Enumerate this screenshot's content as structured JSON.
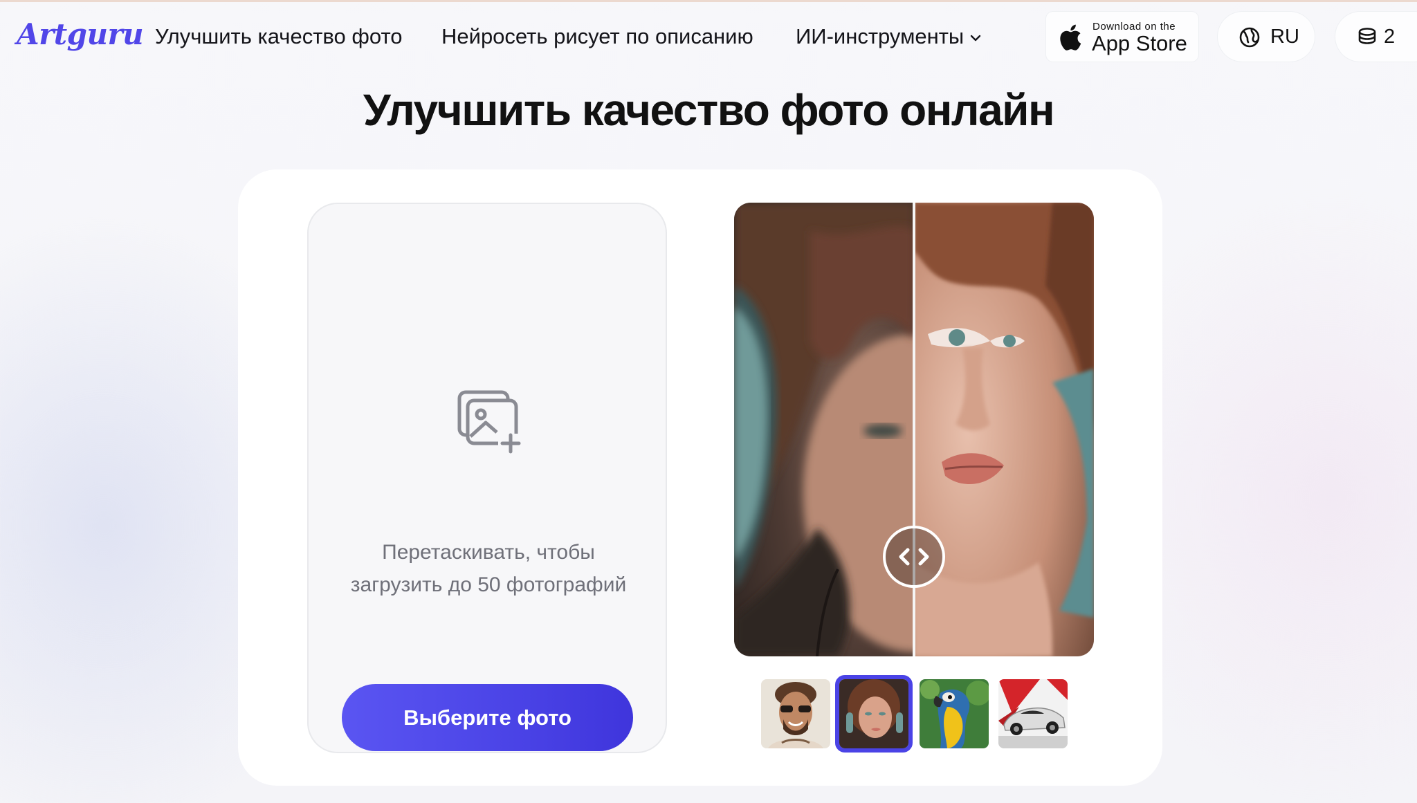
{
  "header": {
    "logo": "Artguru",
    "nav": {
      "enhance": "Улучшить качество фото",
      "generate": "Нейросеть рисует по описанию",
      "tools": "ИИ-инструменты"
    },
    "app_store": {
      "small": "Download on the",
      "big": "App Store"
    },
    "language": "RU",
    "credits": "2"
  },
  "main": {
    "title": "Улучшить качество фото онлайн",
    "upload": {
      "text_line1": "Перетаскивать, чтобы",
      "text_line2": "загрузить до 50 фотографий",
      "button": "Выберите фото"
    },
    "compare": {
      "comparison_split": 0.5
    },
    "samples": {
      "selected_index": 1,
      "items": [
        "man-with-sunglasses",
        "girl-with-headphones",
        "parrot",
        "sports-car"
      ]
    }
  },
  "colors": {
    "brand": "#5146e8",
    "button": "#4a43e6",
    "text": "#111111",
    "muted": "#6f7079"
  }
}
